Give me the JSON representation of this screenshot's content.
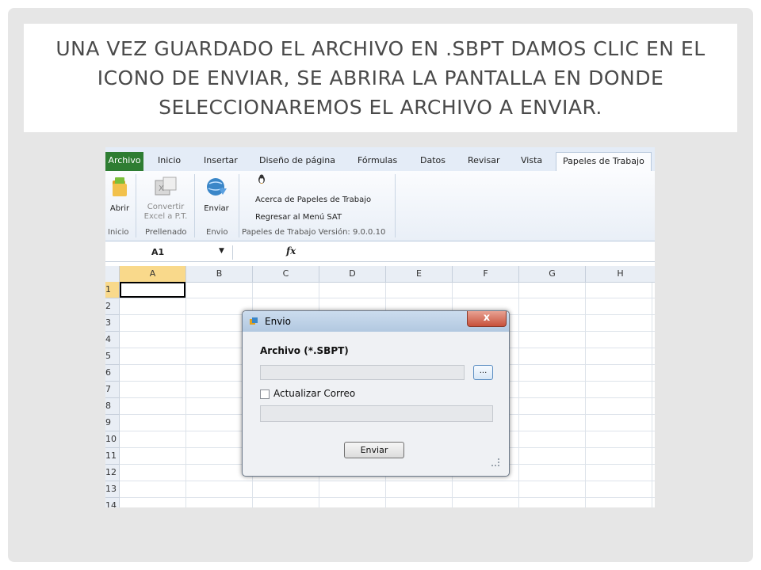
{
  "slide": {
    "title": "UNA VEZ GUARDADO EL ARCHIVO EN .SBPT DAMOS CLIC EN EL ICONO DE ENVIAR, SE ABRIRA LA PANTALLA EN DONDE SELECCIONAREMOS EL ARCHIVO A ENVIAR."
  },
  "ribbon": {
    "tabs": [
      "Archivo",
      "Inicio",
      "Insertar",
      "Diseño de página",
      "Fórmulas",
      "Datos",
      "Revisar",
      "Vista",
      "Papeles de Trabajo"
    ],
    "active_tab": "Papeles de Trabajo",
    "buttons": {
      "abrir": "Abrir",
      "convertir_1": "Convertir",
      "convertir_2": "Excel a P.T.",
      "enviar": "Enviar",
      "acerca": "Acerca de Papeles de Trabajo",
      "regresar": "Regresar al Menú SAT"
    },
    "groups": {
      "inicio": "Inicio",
      "prellenado": "Prellenado",
      "envio": "Envio",
      "version": "Papeles de Trabajo Versión: 9.0.0.10"
    }
  },
  "formula_bar": {
    "name_box": "A1",
    "fx": "fx"
  },
  "grid": {
    "columns": [
      "A",
      "B",
      "C",
      "D",
      "E",
      "F",
      "G",
      "H"
    ],
    "rows": [
      "1",
      "2",
      "3",
      "4",
      "5",
      "6",
      "7",
      "8",
      "9",
      "10",
      "11",
      "12",
      "13",
      "14"
    ]
  },
  "dialog": {
    "title": "Envio",
    "close": "x",
    "archivo_label": "Archivo (*.SBPT)",
    "browse_label": "...",
    "checkbox_label": "Actualizar Correo",
    "checkbox_checked": false,
    "send_label": "Enviar"
  },
  "colors": {
    "file_tab": "#2e7d32",
    "selection_header": "#f9d98b",
    "close_button": "#c7513b"
  }
}
